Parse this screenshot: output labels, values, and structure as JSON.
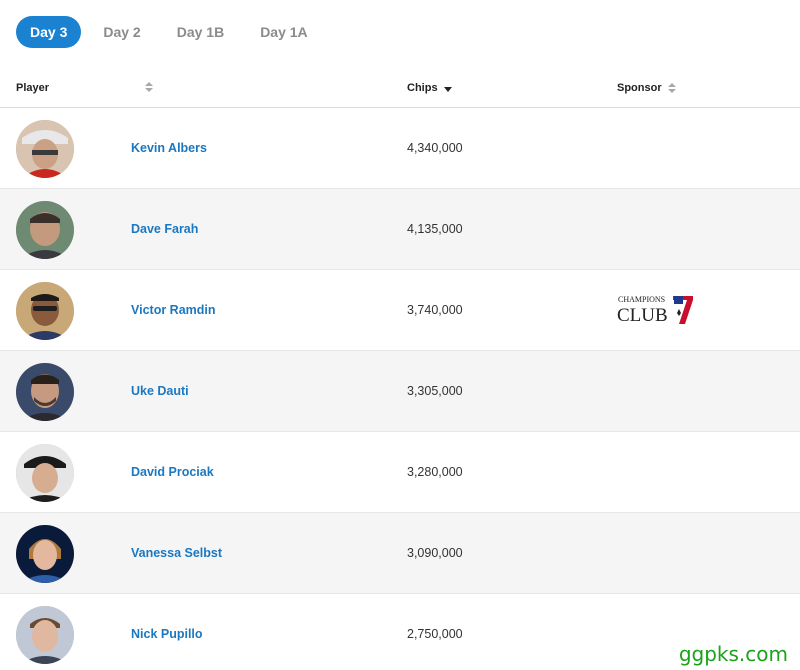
{
  "tabs": [
    {
      "label": "Day 3",
      "active": true
    },
    {
      "label": "Day 2",
      "active": false
    },
    {
      "label": "Day 1B",
      "active": false
    },
    {
      "label": "Day 1A",
      "active": false
    }
  ],
  "columns": {
    "player": "Player",
    "chips": "Chips",
    "sponsor": "Sponsor"
  },
  "rows": [
    {
      "name": "Kevin Albers",
      "chips": "4,340,000",
      "sponsor": ""
    },
    {
      "name": "Dave Farah",
      "chips": "4,135,000",
      "sponsor": ""
    },
    {
      "name": "Victor Ramdin",
      "chips": "3,740,000",
      "sponsor": "Champions Club"
    },
    {
      "name": "Uke Dauti",
      "chips": "3,305,000",
      "sponsor": ""
    },
    {
      "name": "David Prociak",
      "chips": "3,280,000",
      "sponsor": ""
    },
    {
      "name": "Vanessa Selbst",
      "chips": "3,090,000",
      "sponsor": ""
    },
    {
      "name": "Nick Pupillo",
      "chips": "2,750,000",
      "sponsor": ""
    }
  ],
  "sponsor_logo": {
    "top": "CHAMPIONS",
    "bottom": "CLUB",
    "mark": "7"
  },
  "watermark": "ggpks.com",
  "colors": {
    "accent": "#1a82d0",
    "link": "#1a78c2",
    "alt_row": "#f5f5f5"
  }
}
